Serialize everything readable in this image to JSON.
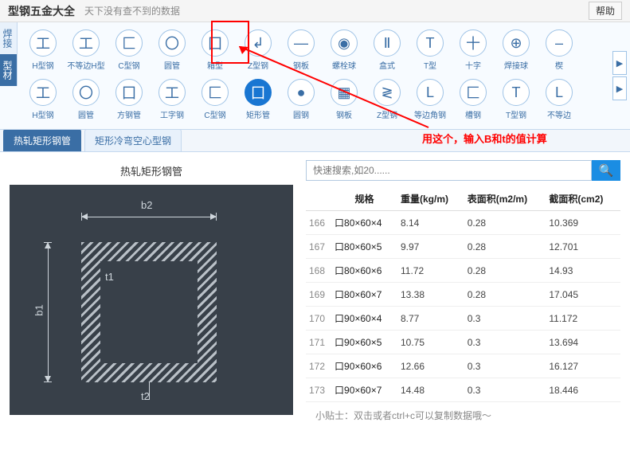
{
  "header": {
    "title": "型钢五金大全",
    "tagline": "天下没有查不到的数据",
    "help": "帮助"
  },
  "side_tabs": [
    "焊接",
    "型材"
  ],
  "ribbon_row1": [
    {
      "glyph": "工",
      "label": "H型钢"
    },
    {
      "glyph": "工",
      "label": "不等边H型"
    },
    {
      "glyph": "匚",
      "label": "C型钢"
    },
    {
      "glyph": "〇",
      "label": "圆管"
    },
    {
      "glyph": "囗",
      "label": "箱型"
    },
    {
      "glyph": "↲",
      "label": "Z型钢"
    },
    {
      "glyph": "—",
      "label": "钢板"
    },
    {
      "glyph": "◉",
      "label": "螺栓球"
    },
    {
      "glyph": "Ⅱ",
      "label": "盒式"
    },
    {
      "glyph": "T",
      "label": "T型"
    },
    {
      "glyph": "十",
      "label": "十字"
    },
    {
      "glyph": "⊕",
      "label": "焊接球"
    },
    {
      "glyph": "–",
      "label": "楔"
    }
  ],
  "ribbon_row2": [
    {
      "glyph": "工",
      "label": "H型钢"
    },
    {
      "glyph": "〇",
      "label": "圆管"
    },
    {
      "glyph": "囗",
      "label": "方钢管"
    },
    {
      "glyph": "工",
      "label": "工字钢"
    },
    {
      "glyph": "匚",
      "label": "C型钢"
    },
    {
      "glyph": "囗",
      "label": "矩形管",
      "selected": true
    },
    {
      "glyph": "●",
      "label": "圆钢"
    },
    {
      "glyph": "▦",
      "label": "钢板"
    },
    {
      "glyph": "≷",
      "label": "Z型钢"
    },
    {
      "glyph": "L",
      "label": "等边角钢"
    },
    {
      "glyph": "匚",
      "label": "槽钢"
    },
    {
      "glyph": "T",
      "label": "T型钢"
    },
    {
      "glyph": "L",
      "label": "不等边"
    }
  ],
  "sub_tabs": [
    {
      "label": "热轧矩形钢管",
      "active": true
    },
    {
      "label": "矩形冷弯空心型钢",
      "active": false
    }
  ],
  "left": {
    "section_title": "热轧矩形钢管",
    "dim_b2": "b2",
    "dim_b1": "b1",
    "dim_t1": "t1",
    "dim_t2": "t2"
  },
  "search": {
    "placeholder": "快速搜索,如20......"
  },
  "table": {
    "headers": [
      "规格",
      "重量(kg/m)",
      "表面积(m2/m)",
      "截面积(cm2)"
    ],
    "rows": [
      {
        "idx": 166,
        "spec": "口80×60×4",
        "w": "8.14",
        "sa": "0.28",
        "ca": "10.369"
      },
      {
        "idx": 167,
        "spec": "口80×60×5",
        "w": "9.97",
        "sa": "0.28",
        "ca": "12.701"
      },
      {
        "idx": 168,
        "spec": "口80×60×6",
        "w": "11.72",
        "sa": "0.28",
        "ca": "14.93"
      },
      {
        "idx": 169,
        "spec": "口80×60×7",
        "w": "13.38",
        "sa": "0.28",
        "ca": "17.045"
      },
      {
        "idx": 170,
        "spec": "口90×60×4",
        "w": "8.77",
        "sa": "0.3",
        "ca": "11.172"
      },
      {
        "idx": 171,
        "spec": "口90×60×5",
        "w": "10.75",
        "sa": "0.3",
        "ca": "13.694"
      },
      {
        "idx": 172,
        "spec": "口90×60×6",
        "w": "12.66",
        "sa": "0.3",
        "ca": "16.127"
      },
      {
        "idx": 173,
        "spec": "口90×60×7",
        "w": "14.48",
        "sa": "0.3",
        "ca": "18.446"
      }
    ]
  },
  "hint": "小贴士：双击或者ctrl+c可以复制数据哦～",
  "annotation": "用这个，输入B和t的值计算"
}
